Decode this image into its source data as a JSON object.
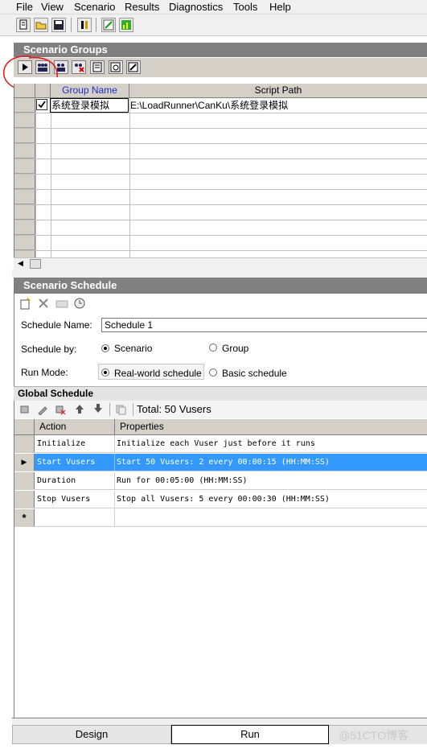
{
  "menu": [
    "File",
    "View",
    "Scenario",
    "Results",
    "Diagnostics",
    "Tools",
    "Help"
  ],
  "scenario_groups": {
    "title": "Scenario Groups",
    "columns": [
      "Group Name",
      "Script Path"
    ],
    "rows": [
      {
        "checked": true,
        "group_name": "系统登录模拟",
        "script_path": "E:\\LoadRunner\\CanKu\\系统登录模拟"
      }
    ]
  },
  "scenario_schedule": {
    "title": "Scenario Schedule",
    "schedule_name_label": "Schedule Name:",
    "schedule_name_value": "Schedule 1",
    "schedule_by_label": "Schedule by:",
    "schedule_by_options": [
      "Scenario",
      "Group"
    ],
    "schedule_by_selected": "Scenario",
    "run_mode_label": "Run Mode:",
    "run_mode_options": [
      "Real-world schedule",
      "Basic schedule"
    ],
    "run_mode_selected": "Real-world schedule"
  },
  "global_schedule": {
    "title": "Global Schedule",
    "total_label": "Total: 50 Vusers",
    "columns": [
      "Action",
      "Properties"
    ],
    "rows": [
      {
        "action": "Initialize",
        "properties": "Initialize each Vuser just before it runs"
      },
      {
        "action": "Start  Vusers",
        "properties": "Start 50 Vusers: 2 every 00:00:15 (HH:MM:SS)",
        "selected": true
      },
      {
        "action": "Duration",
        "properties": "Run for 00:05:00 (HH:MM:SS)"
      },
      {
        "action": "Stop Vusers",
        "properties": "Stop all Vusers: 5 every 00:00:30 (HH:MM:SS)"
      }
    ],
    "new_row_marker": "*"
  },
  "tabs": [
    "Design",
    "Run"
  ],
  "watermark": "@51CTO博客",
  "colors": {
    "selection": "#3399ff",
    "panel_header": "#808080",
    "annotation_circle": "#e02020"
  }
}
